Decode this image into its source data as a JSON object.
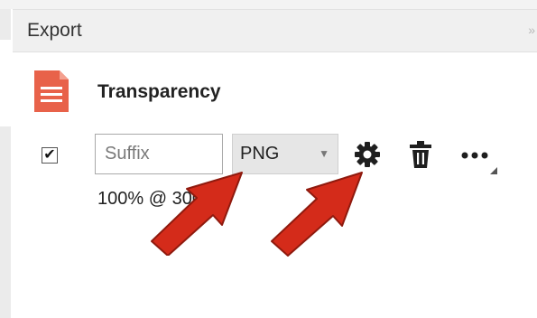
{
  "panel": {
    "title": "Export",
    "collapse_glyph": "»"
  },
  "asset": {
    "icon": "file-icon",
    "icon_color": "#e8624a",
    "name": "Transparency"
  },
  "export_row": {
    "enabled": true,
    "check_glyph": "✔",
    "suffix_placeholder": "Suffix",
    "suffix_value": "",
    "format_value": "PNG",
    "format_arrow": "▼",
    "resolution": "100% @ 300 dpi",
    "icons": [
      "gear-icon",
      "trash-icon",
      "more-icon"
    ]
  },
  "annotations": {
    "arrow_color": "#d42b1a",
    "arrow_count": 2
  }
}
